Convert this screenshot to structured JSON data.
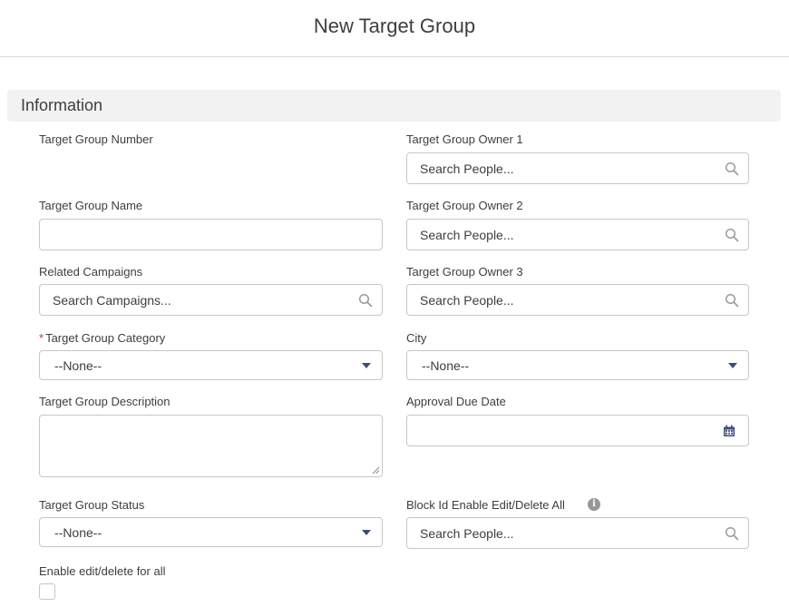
{
  "modal": {
    "title": "New Target Group"
  },
  "section": {
    "title": "Information"
  },
  "left": {
    "number_label": "Target Group Number",
    "name_label": "Target Group Name",
    "name_value": "",
    "campaigns_label": "Related Campaigns",
    "campaigns_placeholder": "Search Campaigns...",
    "category_required_mark": "*",
    "category_label": "Target Group Category",
    "category_value": "--None--",
    "description_label": "Target Group Description",
    "description_value": "",
    "status_label": "Target Group Status",
    "status_value": "--None--",
    "enable_label": "Enable edit/delete for all"
  },
  "right": {
    "owner1_label": "Target Group Owner 1",
    "owner1_placeholder": "Search People...",
    "owner2_label": "Target Group Owner 2",
    "owner2_placeholder": "Search People...",
    "owner3_label": "Target Group Owner 3",
    "owner3_placeholder": "Search People...",
    "city_label": "City",
    "city_value": "--None--",
    "approval_label": "Approval Due Date",
    "approval_value": "",
    "block_label": "Block Id Enable Edit/Delete All",
    "block_info_glyph": "i",
    "block_placeholder": "Search People..."
  },
  "icons": {
    "search": "search-icon",
    "calendar": "calendar-icon",
    "dropdown": "chevron-down-icon",
    "info": "info-icon"
  },
  "colors": {
    "required": "#c23934",
    "caret": "#3e4b7a",
    "calendar": "#3e4b7a"
  }
}
